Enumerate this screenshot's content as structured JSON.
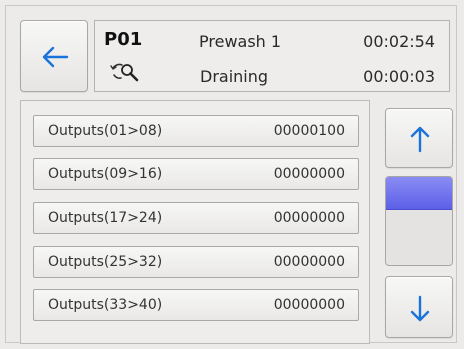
{
  "header": {
    "program": "P01",
    "step_name": "Prewash 1",
    "step_time": "00:02:54",
    "status": "Draining",
    "status_time": "00:00:03"
  },
  "outputs": [
    {
      "label": "Outputs(01>08)",
      "value": "00000100"
    },
    {
      "label": "Outputs(09>16)",
      "value": "00000000"
    },
    {
      "label": "Outputs(17>24)",
      "value": "00000000"
    },
    {
      "label": "Outputs(25>32)",
      "value": "00000000"
    },
    {
      "label": "Outputs(33>40)",
      "value": "00000000"
    }
  ],
  "icons": {
    "back": "arrow-left-icon",
    "status": "draining-cycle-icon",
    "scroll_up": "arrow-up-icon",
    "scroll_down": "arrow-down-icon"
  },
  "colors": {
    "arrow": "#1a73d9",
    "scroll_thumb": "#6468ec"
  },
  "scroll": {
    "thumb_fraction": 0.36
  }
}
